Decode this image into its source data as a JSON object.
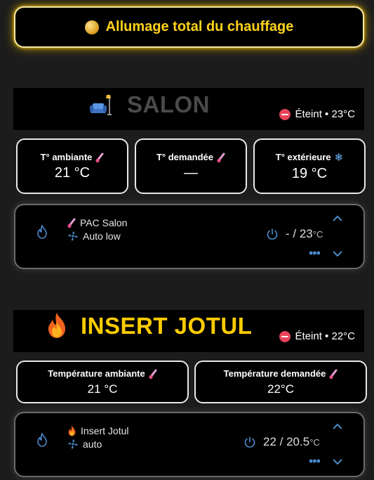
{
  "top_button": {
    "label": "Allumage total du chauffage",
    "icon": "coin-icon"
  },
  "salon": {
    "title": "SALON",
    "title_color": "#4a4a4a",
    "status": "Éteint • 23°C",
    "cards": [
      {
        "label": "T° ambiante",
        "value": "21 °C",
        "icon": "thermometer-icon"
      },
      {
        "label": "T° demandée",
        "value": "—",
        "icon": "thermometer-icon"
      },
      {
        "label": "T° extérieure",
        "value": "19 °C",
        "icon": "snowflake-icon"
      }
    ],
    "climate": {
      "name": "PAC Salon",
      "mode": "Auto low",
      "current": "-",
      "target": "23",
      "unit": "°C"
    }
  },
  "insert": {
    "title": "INSERT JOTUL",
    "title_color": "#ffcc00",
    "status": "Éteint • 22°C",
    "cards": [
      {
        "label": "Température ambiante",
        "value": "21 °C",
        "icon": "thermometer-icon"
      },
      {
        "label": "Température demandée",
        "value": "22°C",
        "icon": "thermometer-icon"
      }
    ],
    "climate": {
      "name": "Insert Jotul",
      "mode": "auto",
      "current": "22",
      "target": "20.5",
      "unit": "°C"
    }
  },
  "colors": {
    "accent_yellow": "#ffd21a",
    "status_red": "#e8445a",
    "icon_blue": "#4b89c9"
  }
}
